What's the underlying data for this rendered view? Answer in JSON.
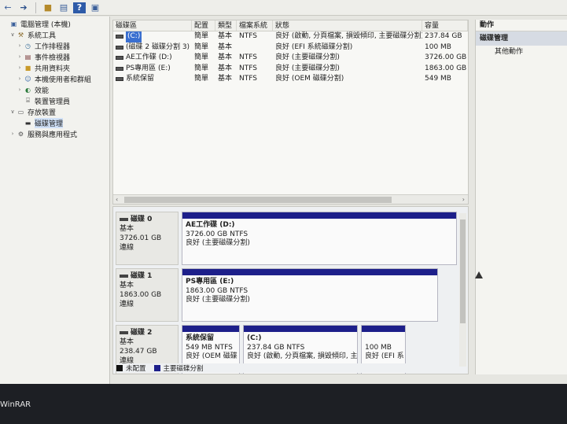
{
  "tree": [
    {
      "label": "電腦管理 (本機)",
      "icon": "computer-management-icon",
      "indent": 0,
      "exp": ""
    },
    {
      "label": "系統工具",
      "icon": "tools-icon",
      "indent": 1,
      "exp": "v"
    },
    {
      "label": "工作排程器",
      "icon": "task-scheduler-icon",
      "indent": 2,
      "exp": ">"
    },
    {
      "label": "事件檢視器",
      "icon": "event-viewer-icon",
      "indent": 2,
      "exp": ">"
    },
    {
      "label": "共用資料夾",
      "icon": "shared-folders-icon",
      "indent": 2,
      "exp": ">"
    },
    {
      "label": "本機使用者和群組",
      "icon": "users-groups-icon",
      "indent": 2,
      "exp": ">"
    },
    {
      "label": "效能",
      "icon": "performance-icon",
      "indent": 2,
      "exp": ">"
    },
    {
      "label": "裝置管理員",
      "icon": "device-manager-icon",
      "indent": 2,
      "exp": ""
    },
    {
      "label": "存放裝置",
      "icon": "storage-icon",
      "indent": 1,
      "exp": "v"
    },
    {
      "label": "磁碟管理",
      "icon": "disk-management-icon",
      "indent": 2,
      "exp": "",
      "selected": true
    },
    {
      "label": "服務與應用程式",
      "icon": "services-icon",
      "indent": 1,
      "exp": ">"
    }
  ],
  "volumes": {
    "headers": [
      "磁碟區",
      "配置",
      "類型",
      "檔案系統",
      "狀態",
      "容量"
    ],
    "rows": [
      {
        "name": "(C:)",
        "layout": "簡單",
        "type": "基本",
        "fs": "NTFS",
        "status": "良好 (啟動, 分頁檔案, 損毀傾印, 主要磁碟分割)",
        "cap": "237.84 GB",
        "selected": true
      },
      {
        "name": "(磁碟 2 磁碟分割 3)",
        "layout": "簡單",
        "type": "基本",
        "fs": "",
        "status": "良好 (EFI 系統磁碟分割)",
        "cap": "100 MB"
      },
      {
        "name": "AE工作碟 (D:)",
        "layout": "簡單",
        "type": "基本",
        "fs": "NTFS",
        "status": "良好 (主要磁碟分割)",
        "cap": "3726.00 GB"
      },
      {
        "name": "PS專用區 (E:)",
        "layout": "簡單",
        "type": "基本",
        "fs": "NTFS",
        "status": "良好 (主要磁碟分割)",
        "cap": "1863.00 GB"
      },
      {
        "name": "系統保留",
        "layout": "簡單",
        "type": "基本",
        "fs": "NTFS",
        "status": "良好 (OEM 磁碟分割)",
        "cap": "549 MB"
      }
    ]
  },
  "disks": [
    {
      "name": "磁碟 0",
      "type": "基本",
      "size": "3726.01 GB",
      "state": "連線",
      "parts": [
        {
          "name": "AE工作碟 (D:)",
          "size": "3726.00 GB NTFS",
          "status": "良好 (主要磁碟分割)"
        }
      ]
    },
    {
      "name": "磁碟 1",
      "type": "基本",
      "size": "1863.00 GB",
      "state": "連線",
      "parts": [
        {
          "name": "PS專用區 (E:)",
          "size": "1863.00 GB NTFS",
          "status": "良好 (主要磁碟分割)"
        }
      ]
    },
    {
      "name": "磁碟 2",
      "type": "基本",
      "size": "238.47 GB",
      "state": "連線",
      "parts": [
        {
          "name": "系統保留",
          "size": "549 MB NTFS",
          "status": "良好 (OEM 磁碟"
        },
        {
          "name": "(C:)",
          "size": "237.84 GB NTFS",
          "status": "良好 (啟動, 分頁檔案, 損毀傾印, 主要"
        },
        {
          "name": "",
          "size": "100 MB",
          "status": "良好 (EFI 系"
        }
      ]
    }
  ],
  "legend": [
    {
      "label": "未配置",
      "color": "#111111"
    },
    {
      "label": "主要磁碟分割",
      "color": "#1d1f8a"
    }
  ],
  "actions": {
    "header": "動作",
    "section": "磁碟管理",
    "items": [
      "其他動作"
    ]
  },
  "taskbar": {
    "app_label": "WinRAR"
  },
  "colors": {
    "partition_bar": "#1d1f8a",
    "selection": "#3a6fd0"
  }
}
